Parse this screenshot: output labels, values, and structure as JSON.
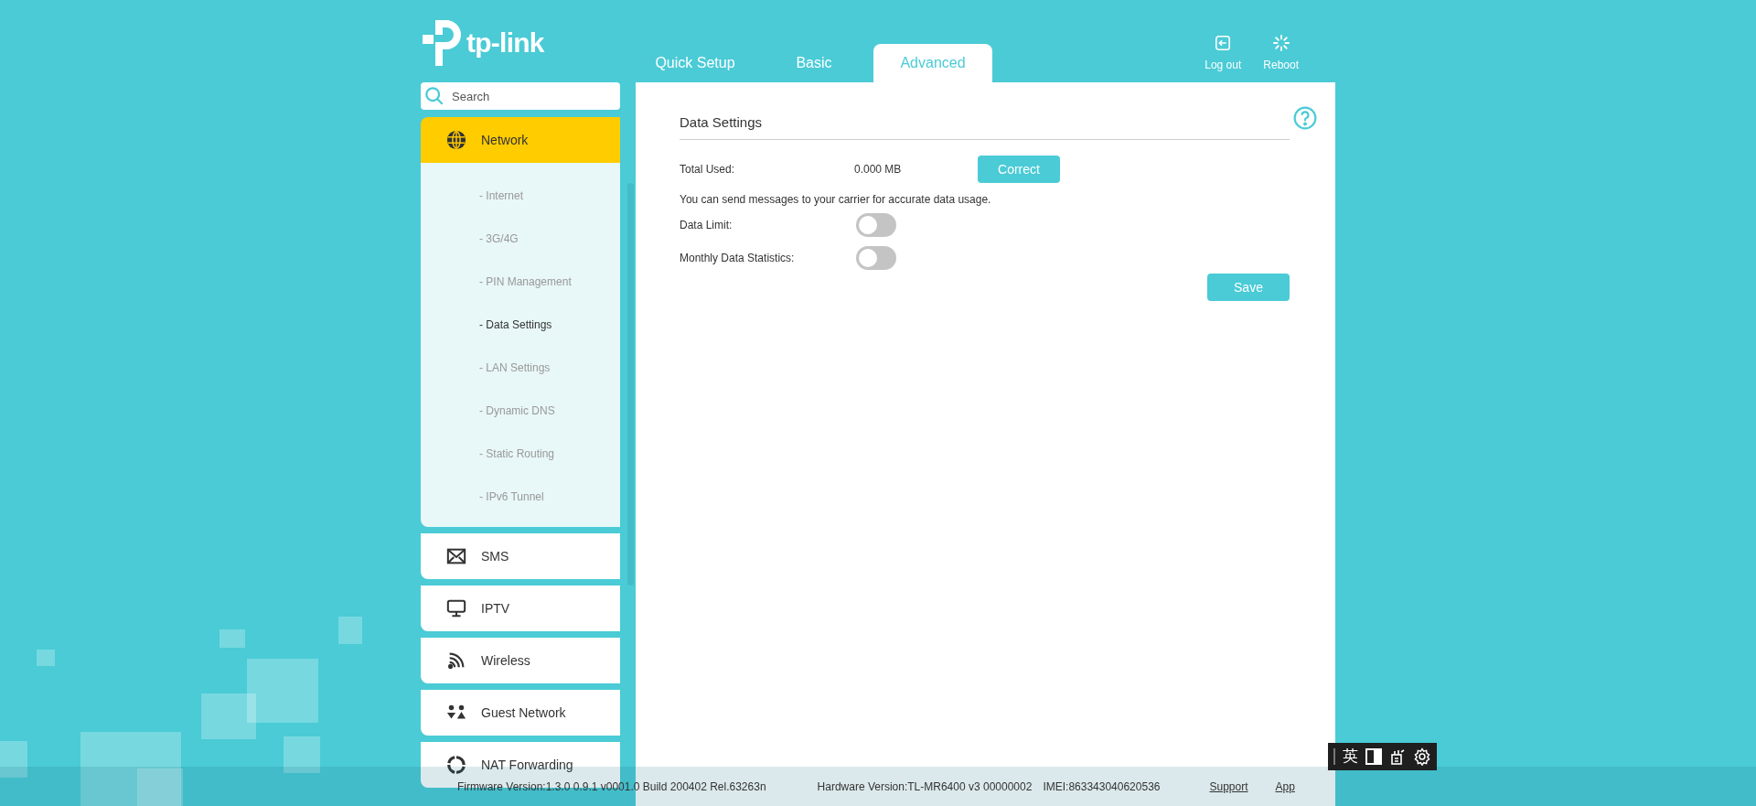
{
  "header": {
    "logo": "tp-link",
    "tabs": [
      {
        "label": "Quick Setup",
        "selected": false
      },
      {
        "label": "Basic",
        "selected": false
      },
      {
        "label": "Advanced",
        "selected": true
      }
    ],
    "actions": [
      {
        "kind": "logout",
        "label": "Log out"
      },
      {
        "kind": "reboot",
        "label": "Reboot"
      }
    ]
  },
  "sidebar": {
    "search": {
      "placeholder": "Search"
    },
    "items": [
      {
        "kind": "globe",
        "label": "Network",
        "selected": true,
        "expanded": true,
        "children": [
          {
            "label": "- Internet",
            "selected": false
          },
          {
            "label": "- 3G/4G",
            "selected": false
          },
          {
            "label": "- PIN Management",
            "selected": false
          },
          {
            "label": "- Data Settings",
            "selected": true
          },
          {
            "label": "- LAN Settings",
            "selected": false
          },
          {
            "label": "- Dynamic DNS",
            "selected": false
          },
          {
            "label": "- Static Routing",
            "selected": false
          },
          {
            "label": "- IPv6 Tunnel",
            "selected": false
          }
        ]
      },
      {
        "kind": "mail",
        "label": "SMS",
        "selected": false
      },
      {
        "kind": "monitor",
        "label": "IPTV",
        "selected": false
      },
      {
        "kind": "wireless",
        "label": "Wireless",
        "selected": false
      },
      {
        "kind": "guest",
        "label": "Guest Network",
        "selected": false
      },
      {
        "kind": "nat",
        "label": "NAT Forwarding",
        "selected": false
      }
    ]
  },
  "panel": {
    "title": "Data Settings",
    "total_used": {
      "label": "Total Used:",
      "value": "0.000 MB",
      "button": "Correct"
    },
    "note": "You can send messages to your carrier for accurate data usage.",
    "toggles": [
      {
        "label": "Data Limit:",
        "on": false
      },
      {
        "label": "Monthly Data Statistics:",
        "on": false
      }
    ],
    "save": "Save"
  },
  "footer": {
    "firmware": "Firmware Version:1.3.0 0.9.1 v0001.0 Build 200402 Rel.63263n",
    "hardware": "Hardware Version:TL-MR6400 v3 00000002",
    "imei": "IMEI:863343040620536",
    "links": [
      "Support",
      "App"
    ]
  },
  "ime_toolbar": {
    "mode": "英"
  }
}
